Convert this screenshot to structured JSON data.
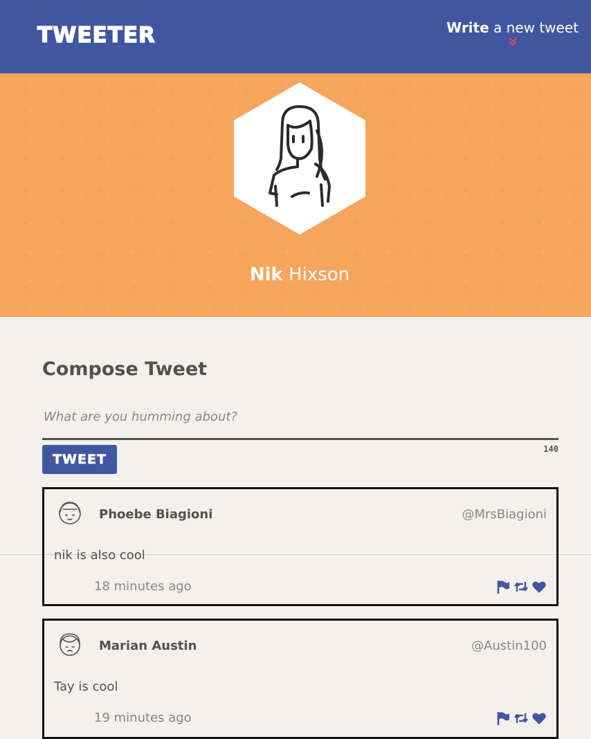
{
  "navbar": {
    "logo": "TWEETER",
    "compose_toggle": {
      "bold": "Write",
      "rest": " a new tweet"
    }
  },
  "profile": {
    "first_name": "Nik",
    "last_name": " Hixson"
  },
  "compose": {
    "title": "Compose Tweet",
    "placeholder": "What are you humming about?",
    "button_label": "TWEET",
    "char_count": "140"
  },
  "tweets": [
    {
      "name": "Phoebe Biagioni",
      "handle": "@MrsBiagioni",
      "content": "nik is also cool",
      "time": "18 minutes ago"
    },
    {
      "name": "Marian Austin",
      "handle": "@Austin100",
      "content": "Tay is cool",
      "time": "19 minutes ago"
    }
  ],
  "colors": {
    "navbar": "#4056a1",
    "banner": "#f6a55c",
    "background": "#f4f1ec",
    "text": "#545149",
    "accent_red": "#e8485b"
  },
  "icons": {
    "chevron": "double-chevron-down-icon",
    "flag": "flag-icon",
    "retweet": "retweet-icon",
    "like": "heart-icon"
  }
}
